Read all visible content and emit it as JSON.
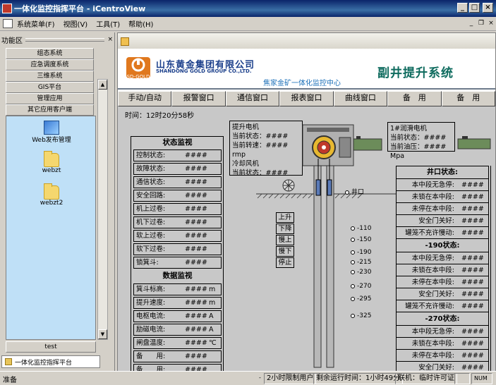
{
  "window": {
    "title": "一体化监控指挥平台 - iCentroView"
  },
  "menu": {
    "items": [
      "系统菜单(F)",
      "视图(V)",
      "工具(T)",
      "帮助(H)"
    ]
  },
  "left_panel": {
    "title": "功能区",
    "categories": [
      "组态系统",
      "应急调度系统",
      "三维系统",
      "GIS平台",
      "管理应用",
      "其它应用客户端"
    ],
    "icons": [
      "Web发布管理",
      "webzt",
      "webzt2"
    ],
    "footer": "test",
    "tab": "一体化监控指挥平台"
  },
  "banner": {
    "logo_badge": "SD-GOLD",
    "company_cn": "山东黄金集团有限公司",
    "company_en": "SHANDONG GOLD GROUP CO.,LTD.",
    "center_name": "焦家金矿一体化监控中心",
    "system_title": "副井提升系统"
  },
  "toolbar": [
    "手动/自动",
    "报警窗口",
    "通信窗口",
    "报表窗口",
    "曲线窗口",
    "备　用",
    "备　用"
  ],
  "time_label": "时间：12时20分58秒",
  "status_panel": {
    "title": "状态监视",
    "rows": [
      {
        "label": "控制状态:",
        "value": "####"
      },
      {
        "label": "故障状态:",
        "value": "####"
      },
      {
        "label": "通信状态:",
        "value": "####"
      },
      {
        "label": "安全回路:",
        "value": "####"
      },
      {
        "label": "机上过卷:",
        "value": "####"
      },
      {
        "label": "机下过卷:",
        "value": "####"
      },
      {
        "label": "软上过卷:",
        "value": "####"
      },
      {
        "label": "软下过卷:",
        "value": "####"
      },
      {
        "label": "锁箕斗:",
        "value": "####"
      }
    ],
    "data_title": "数据监视",
    "data_rows": [
      {
        "label": "箕斗标高:",
        "value": "####",
        "unit": "m"
      },
      {
        "label": "提升速度:",
        "value": "####",
        "unit": "m"
      },
      {
        "label": "电枢电流:",
        "value": "####",
        "unit": "A"
      },
      {
        "label": "励磁电流:",
        "value": "####",
        "unit": "A"
      },
      {
        "label": "闸盘温度:",
        "value": "####",
        "unit": "℃"
      },
      {
        "label": "备　　用:",
        "value": "####",
        "unit": ""
      },
      {
        "label": "备　　用:",
        "value": "####",
        "unit": ""
      }
    ]
  },
  "motor_box": {
    "lines": [
      "提升电机",
      "当前状态：####",
      "当前转速：#### rmp",
      "冷却风机",
      "当前状态：####"
    ]
  },
  "lube_box": {
    "lines": [
      "1#润滑电机",
      "当前状态：####",
      "当前油压：#### Mpa"
    ]
  },
  "shaft": {
    "wellhead": "井口",
    "levels": [
      "-110",
      "-150",
      "-190",
      "-215",
      "-230",
      "-270",
      "-295",
      "-325"
    ],
    "controls": [
      "上升",
      "下降",
      "慢上",
      "慢下",
      "停止"
    ]
  },
  "right_table": {
    "sections": [
      {
        "title": "井口状态:",
        "rows": [
          "本中段无急停:",
          "未锁在本中段:",
          "未停在本中段:",
          "安全门关好:",
          "罐笼不充许慢动:"
        ]
      },
      {
        "title": "-190状态:",
        "rows": [
          "本中段无急停:",
          "未锁在本中段:",
          "未停在本中段:",
          "安全门关好:",
          "罐笼不充许慢动:"
        ]
      },
      {
        "title": "-270状态:",
        "rows": [
          "本中段无急停:",
          "未锁在本中段:",
          "未停在本中段:",
          "安全门关好:"
        ]
      }
    ],
    "value": "####"
  },
  "statusbar": {
    "left": "准备",
    "user": "2小时限制用户",
    "runtime": "剩余运行时间：1小时49分",
    "license": "联机：临时许可证",
    "num": "NUM"
  }
}
